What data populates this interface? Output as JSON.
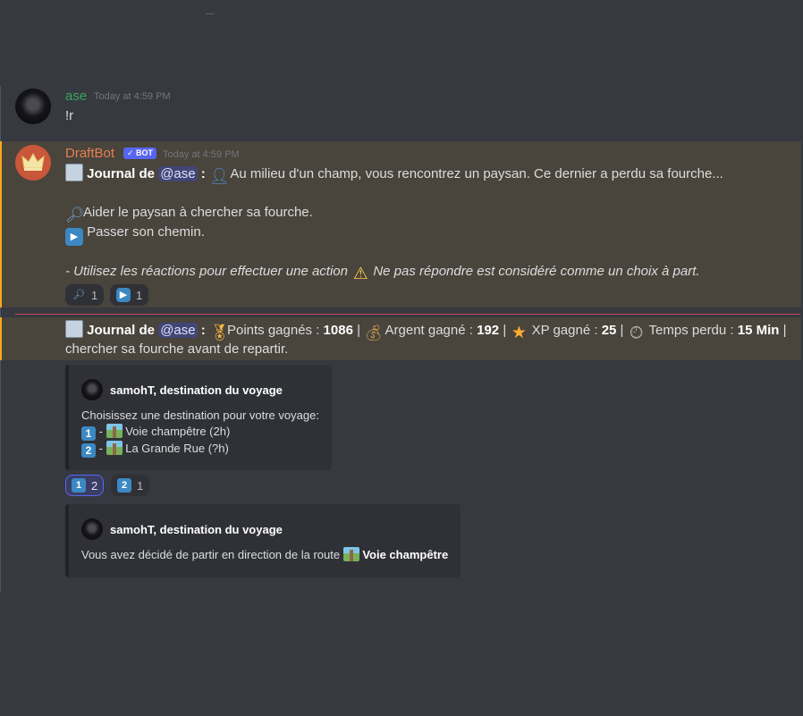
{
  "top_mark": "—",
  "messages": {
    "user_msg": {
      "username": "ase",
      "username_color": "#3ba55c",
      "timestamp": "Today at 4:59 PM",
      "content": "!r"
    },
    "bot_msg": {
      "username": "DraftBot",
      "username_color": "#e67e52",
      "bot_tag": "✓ BOT",
      "timestamp": "Today at 4:59 PM",
      "line1_prefix": "Journal de",
      "mention": "@ase",
      "colon": ":",
      "line1_text": "Au milieu d'un champ, vous rencontrez un paysan. Ce dernier a perdu sa fourche...",
      "option1": "Aider le paysan à chercher sa fourche.",
      "option2": "Passer son chemin.",
      "note_part1": "- Utilisez les réactions pour effectuer une action",
      "note_part2": "Ne pas répondre est considéré comme un choix à part.",
      "reactions": [
        {
          "emoji": "search-icon",
          "count": "1"
        },
        {
          "emoji": "play-icon",
          "count": "1"
        }
      ]
    },
    "result_msg": {
      "prefix": "Journal de",
      "mention": "@ase",
      "colon": ":",
      "points_label": "Points gagnés :",
      "points_value": "1086",
      "money_label": "Argent gagné :",
      "money_value": "192",
      "xp_label": "XP gagné :",
      "xp_value": "25",
      "time_label": "Temps perdu :",
      "time_value": "15 Min",
      "sep": "|",
      "line2": "chercher sa fourche avant de repartir."
    },
    "embed1": {
      "author": "samohT, destination du voyage",
      "desc_line": "Choisissez une destination pour votre voyage:",
      "items": [
        {
          "num": "1",
          "dash": "-",
          "label": "Voie champêtre (2h)"
        },
        {
          "num": "2",
          "dash": "-",
          "label": "La Grande Rue (?h)"
        }
      ],
      "reactions": [
        {
          "num": "1",
          "count": "2"
        },
        {
          "num": "2",
          "count": "1"
        }
      ]
    },
    "embed2": {
      "author": "samohT, destination du voyage",
      "desc_text": "Vous avez décidé de partir en direction de la route",
      "desc_bold": "Voie champêtre"
    }
  }
}
